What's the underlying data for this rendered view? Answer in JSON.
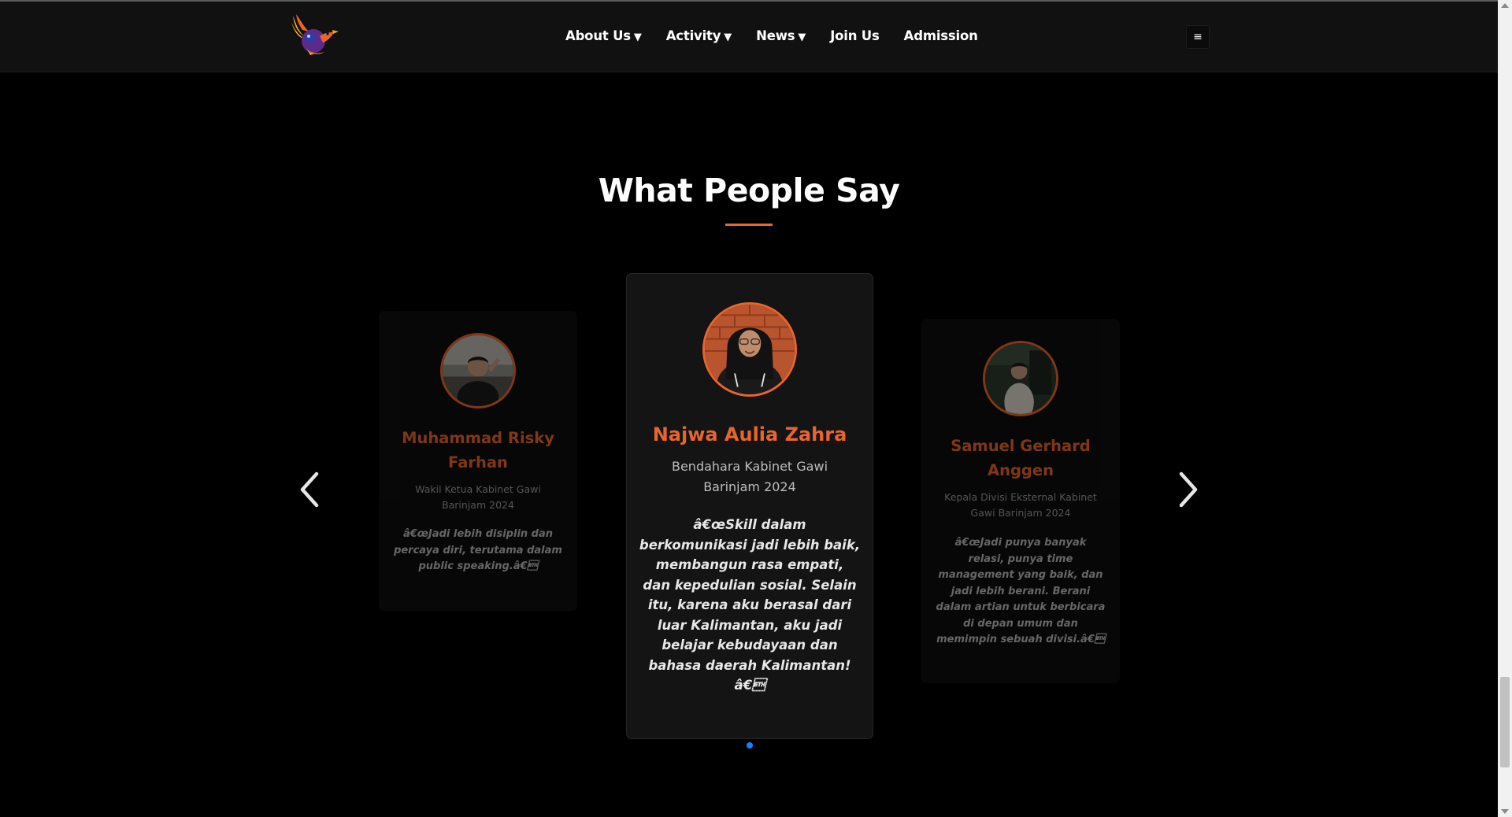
{
  "nav": {
    "items": [
      {
        "label": "About Us",
        "has_dropdown": true
      },
      {
        "label": "Activity",
        "has_dropdown": true
      },
      {
        "label": "News",
        "has_dropdown": true
      },
      {
        "label": "Join Us",
        "has_dropdown": false
      },
      {
        "label": "Admission",
        "has_dropdown": false
      }
    ],
    "caret": "▼",
    "menu_icon": "≡"
  },
  "section": {
    "title": "What People Say"
  },
  "testimonials": [
    {
      "name_line1": "Muhammad Risky",
      "name_line2": "Farhan",
      "role_line1": "Wakil Ketua Kabinet Gawi",
      "role_line2": "Barinjam 2024",
      "quote_lines": [
        "â€œJadi lebih disiplin dan",
        "percaya diri, terutama dalam",
        "public speaking.â€\u0003"
      ]
    },
    {
      "name_line1": "Najwa Aulia Zahra",
      "role_line1": "Bendahara Kabinet Gawi",
      "role_line2": "Barinjam 2024",
      "quote_lines": [
        "â€œSkill dalam",
        "berkomunikasi jadi lebih baik,",
        "membangun rasa empati,",
        "dan kepedulian sosial. Selain",
        "itu, karena aku berasal dari",
        "luar Kalimantan, aku jadi",
        "belajar kebudayaan dan",
        "bahasa daerah Kalimantan!",
        "â€\u0003"
      ]
    },
    {
      "name_line1": "Samuel Gerhard",
      "name_line2": "Anggen",
      "role_line1": "Kepala Divisi Eksternal Kabinet",
      "role_line2": "Gawi Barinjam 2024",
      "quote_lines": [
        "â€œJadi punya banyak",
        "relasi, punya time",
        "management yang baik, dan",
        "jadi lebih berani. Berani",
        "dalam artian untuk berbicara",
        "di depan umum dan",
        "memimpin sebuah divisi.â€\u0003"
      ]
    }
  ],
  "colors": {
    "accent": "#e8652b",
    "dot_active": "#1e7bff",
    "background": "#000000",
    "navbar": "#111111"
  },
  "carousel": {
    "active_index": 1,
    "dot_count": 1
  }
}
